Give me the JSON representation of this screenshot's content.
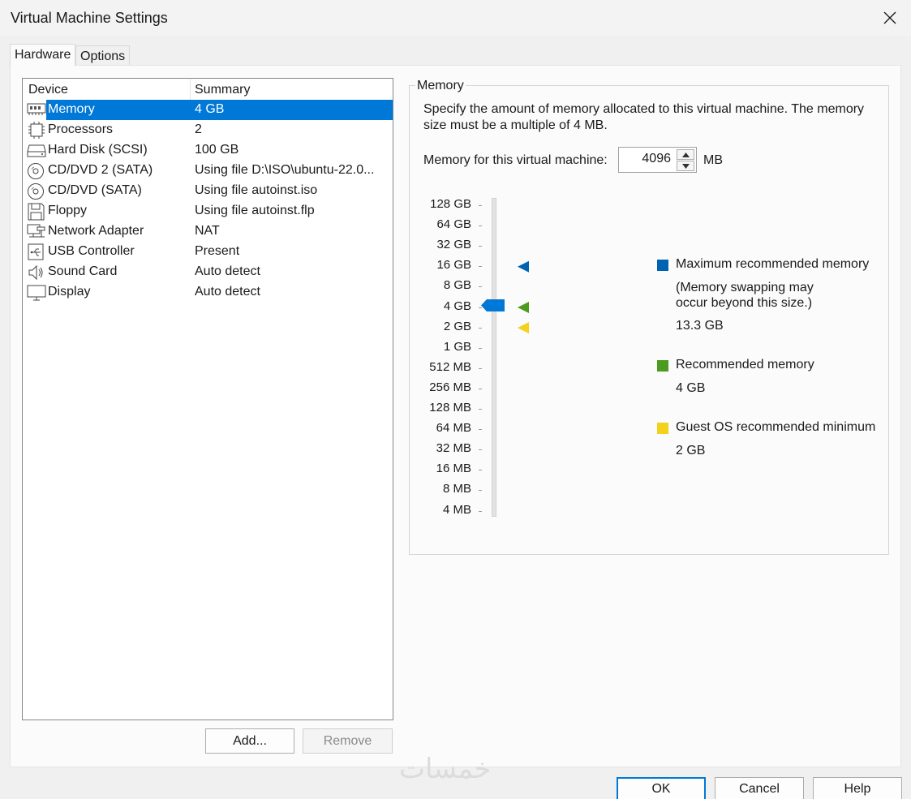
{
  "window": {
    "title": "Virtual Machine Settings"
  },
  "tabs": [
    {
      "label": "Hardware",
      "active": true
    },
    {
      "label": "Options",
      "active": false
    }
  ],
  "device_list": {
    "columns": [
      "Device",
      "Summary"
    ],
    "rows": [
      {
        "icon": "memory-icon",
        "device": "Memory",
        "summary": "4 GB",
        "selected": true
      },
      {
        "icon": "processor-icon",
        "device": "Processors",
        "summary": "2"
      },
      {
        "icon": "hard-disk-icon",
        "device": "Hard Disk (SCSI)",
        "summary": "100 GB"
      },
      {
        "icon": "cd-dvd-icon",
        "device": "CD/DVD 2 (SATA)",
        "summary": "Using file D:\\ISO\\ubuntu-22.0..."
      },
      {
        "icon": "cd-dvd-icon",
        "device": "CD/DVD (SATA)",
        "summary": "Using file autoinst.iso"
      },
      {
        "icon": "floppy-icon",
        "device": "Floppy",
        "summary": "Using file autoinst.flp"
      },
      {
        "icon": "network-adapter-icon",
        "device": "Network Adapter",
        "summary": "NAT"
      },
      {
        "icon": "usb-icon",
        "device": "USB Controller",
        "summary": "Present"
      },
      {
        "icon": "speaker-icon",
        "device": "Sound Card",
        "summary": "Auto detect"
      },
      {
        "icon": "display-icon",
        "device": "Display",
        "summary": "Auto detect"
      }
    ]
  },
  "list_buttons": {
    "add": "Add...",
    "remove": "Remove"
  },
  "memory_panel": {
    "group_title": "Memory",
    "description": "Specify the amount of memory allocated to this virtual machine. The memory size must be a multiple of 4 MB.",
    "input_label": "Memory for this virtual machine:",
    "value": "4096",
    "unit": "MB",
    "scale_labels": [
      "128 GB",
      "64 GB",
      "32 GB",
      "16 GB",
      "8 GB",
      "4 GB",
      "2 GB",
      "1 GB",
      "512 MB",
      "256 MB",
      "128 MB",
      "64 MB",
      "32 MB",
      "16 MB",
      "8 MB",
      "4 MB"
    ],
    "slider_value": "4 GB",
    "legend": [
      {
        "color": "#0063b1",
        "label": "Maximum recommended memory",
        "note": [
          "(Memory swapping may",
          "occur beyond this size.)"
        ],
        "value": "13.3 GB",
        "marker_at": "16 GB"
      },
      {
        "color": "#4c9a1e",
        "label": "Recommended memory",
        "value": "4 GB",
        "marker_at": "4 GB"
      },
      {
        "color": "#f2d21c",
        "label": "Guest OS recommended minimum",
        "value": "2 GB",
        "marker_at": "2 GB"
      }
    ]
  },
  "footer_buttons": {
    "ok": "OK",
    "cancel": "Cancel",
    "help": "Help"
  },
  "watermark": "خمسات"
}
